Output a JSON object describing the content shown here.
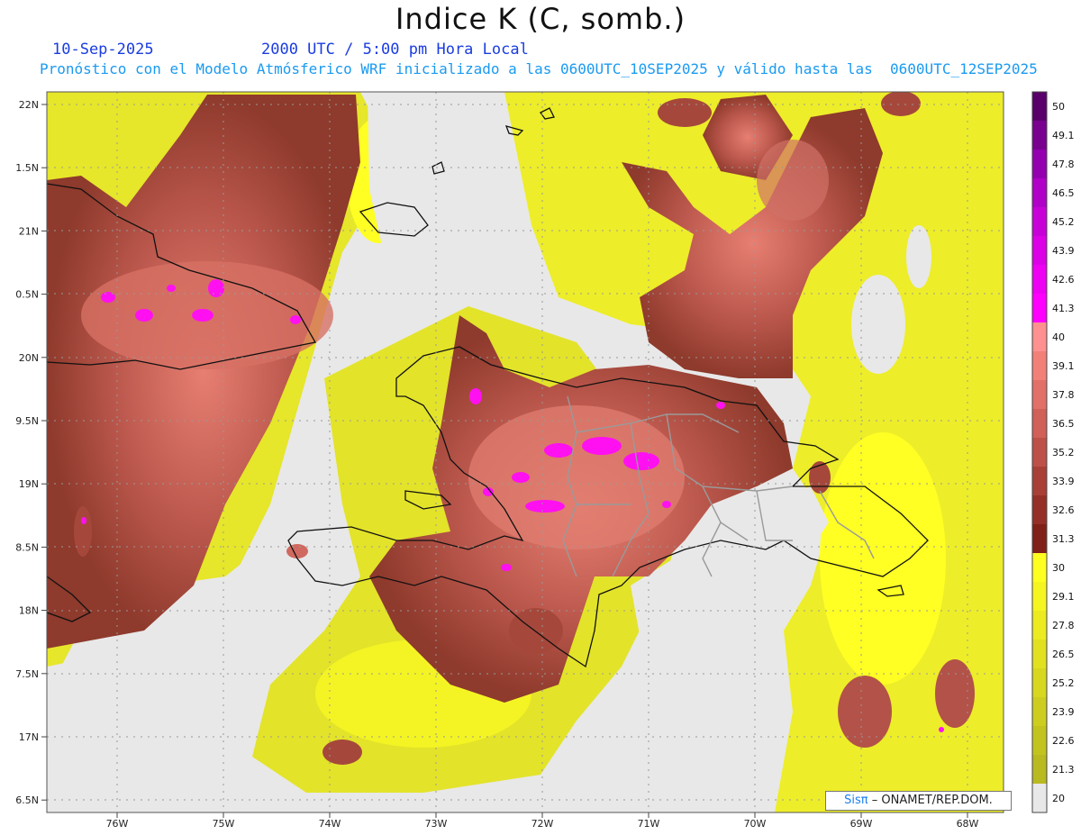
{
  "header": {
    "title": "Indice K (C, somb.)",
    "date": "10-Sep-2025",
    "time": "2000 UTC / 5:00 pm Hora Local",
    "model_line": "Pronóstico con el Modelo Atmósferico WRF inicializado a las 0600UTC_10SEP2025 y válido hasta las  0600UTC_12SEP2025"
  },
  "map": {
    "lat_labels": [
      "22N",
      "1.5N",
      "21N",
      "0.5N",
      "20N",
      "9.5N",
      "19N",
      "8.5N",
      "18N",
      "7.5N",
      "17N",
      "6.5N"
    ],
    "lon_labels": [
      "76W",
      "75W",
      "74W",
      "73W",
      "72W",
      "71W",
      "70W",
      "69W",
      "68W"
    ],
    "land_color": "#e8e8e8",
    "grid_style": "dotted"
  },
  "legend": {
    "values": [
      "50",
      "49.1",
      "47.8",
      "46.5",
      "45.2",
      "43.9",
      "42.6",
      "41.3",
      "40",
      "39.1",
      "37.8",
      "36.5",
      "35.2",
      "33.9",
      "32.6",
      "31.3",
      "30",
      "29.1",
      "27.8",
      "26.5",
      "25.2",
      "23.9",
      "22.6",
      "21.3",
      "20"
    ],
    "colors": [
      "#5a006a",
      "#7a0090",
      "#9400b0",
      "#b000c8",
      "#c800d8",
      "#dc00e6",
      "#ee00f2",
      "#ff00ff",
      "#ff9090",
      "#f38078",
      "#e27068",
      "#d06058",
      "#bd5048",
      "#a84038",
      "#943028",
      "#802018",
      "#ffff20",
      "#f5f520",
      "#ebeb20",
      "#e1e120",
      "#d7d720",
      "#cdcd20",
      "#c3c320",
      "#b9b920",
      "#e8e8e8"
    ]
  },
  "credit": {
    "sis": "Sisπ",
    "text": "– ONAMET/REP.DOM."
  }
}
